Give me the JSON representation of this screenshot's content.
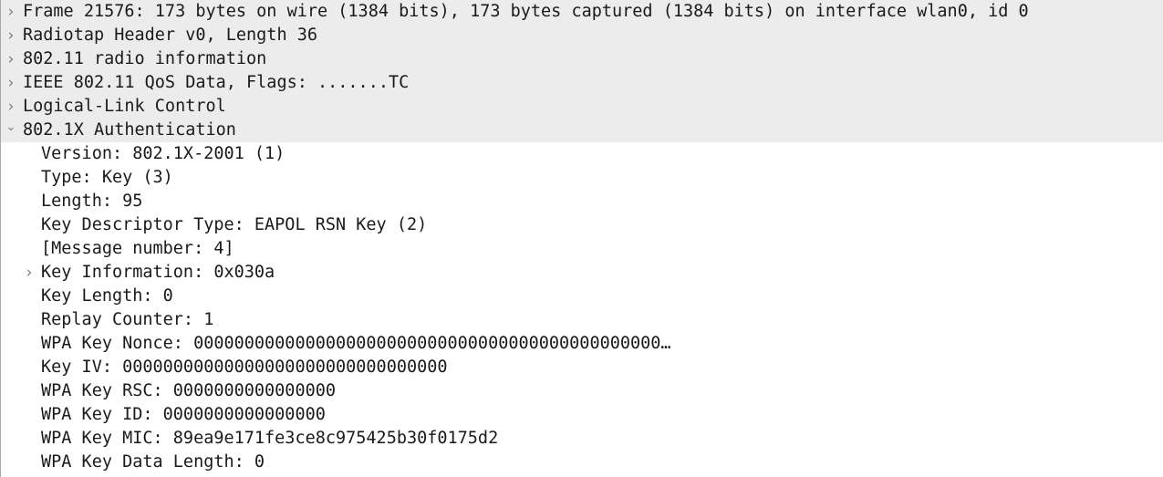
{
  "packet_details": {
    "rows": [
      {
        "level": 0,
        "expander": "collapsed",
        "icon": "chevron-right-icon",
        "text": "Frame 21576: 173 bytes on wire (1384 bits), 173 bytes captured (1384 bits) on interface wlan0, id 0"
      },
      {
        "level": 0,
        "expander": "collapsed",
        "icon": "chevron-right-icon",
        "text": "Radiotap Header v0, Length 36"
      },
      {
        "level": 0,
        "expander": "collapsed",
        "icon": "chevron-right-icon",
        "text": "802.11 radio information"
      },
      {
        "level": 0,
        "expander": "collapsed",
        "icon": "chevron-right-icon",
        "text": "IEEE 802.11 QoS Data, Flags: .......TC"
      },
      {
        "level": 0,
        "expander": "collapsed",
        "icon": "chevron-right-icon",
        "text": "Logical-Link Control"
      },
      {
        "level": 0,
        "expander": "expanded",
        "icon": "chevron-down-icon",
        "text": "802.1X Authentication"
      },
      {
        "level": 1,
        "expander": "none",
        "text": "Version: 802.1X-2001 (1)"
      },
      {
        "level": 1,
        "expander": "none",
        "text": "Type: Key (3)"
      },
      {
        "level": 1,
        "expander": "none",
        "text": "Length: 95"
      },
      {
        "level": 1,
        "expander": "none",
        "text": "Key Descriptor Type: EAPOL RSN Key (2)"
      },
      {
        "level": 1,
        "expander": "none",
        "text": "[Message number: 4]"
      },
      {
        "level": 1,
        "expander": "collapsed",
        "icon": "chevron-right-icon",
        "text": "Key Information: 0x030a"
      },
      {
        "level": 1,
        "expander": "none",
        "text": "Key Length: 0"
      },
      {
        "level": 1,
        "expander": "none",
        "text": "Replay Counter: 1"
      },
      {
        "level": 1,
        "expander": "none",
        "text": "WPA Key Nonce: 0000000000000000000000000000000000000000000000…"
      },
      {
        "level": 1,
        "expander": "none",
        "text": "Key IV: 00000000000000000000000000000000"
      },
      {
        "level": 1,
        "expander": "none",
        "text": "WPA Key RSC: 0000000000000000"
      },
      {
        "level": 1,
        "expander": "none",
        "text": "WPA Key ID: 0000000000000000"
      },
      {
        "level": 1,
        "expander": "none",
        "text": "WPA Key MIC: 89ea9e171fe3ce8c975425b30f0175d2"
      },
      {
        "level": 1,
        "expander": "none",
        "text": "WPA Key Data Length: 0"
      }
    ]
  },
  "colors": {
    "top_level_row_background": "#ececec",
    "text": "#1a1a1a",
    "expander": "#7a7a7a"
  }
}
